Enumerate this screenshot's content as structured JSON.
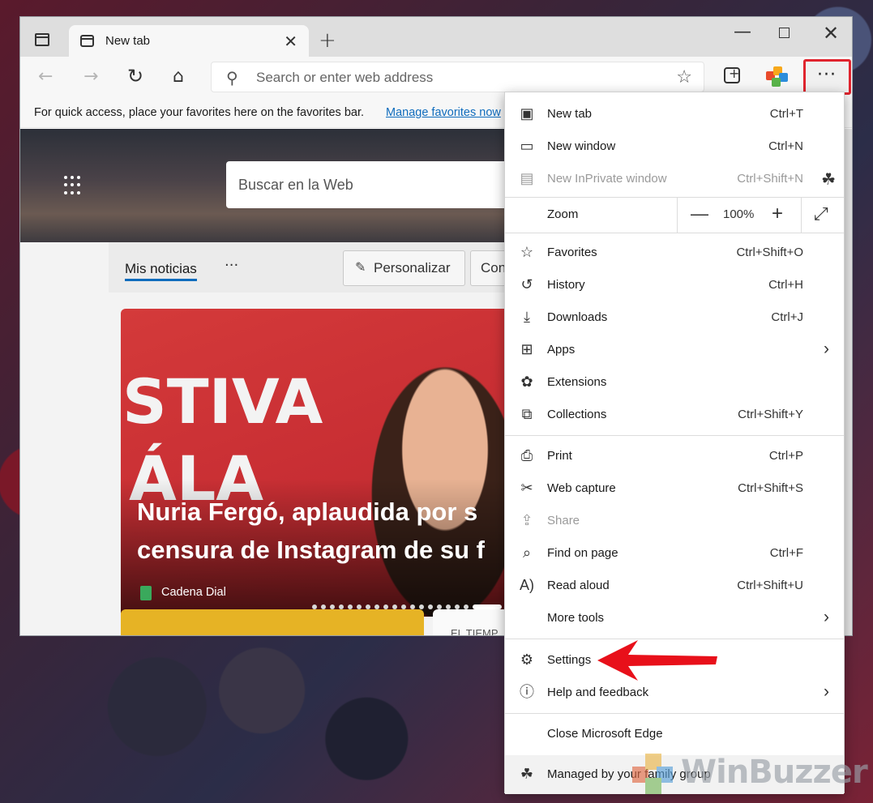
{
  "tab": {
    "title": "New tab"
  },
  "address": {
    "placeholder": "Search or enter web address"
  },
  "favorites_bar": {
    "text": "For quick access, place your favorites here on the favorites bar.",
    "link": "Manage favorites now"
  },
  "page": {
    "web_search_placeholder": "Buscar en la Web",
    "news_tab": "Mis noticias",
    "more": "···",
    "personalize": "Personalizar",
    "second_button": "Con",
    "headline_line1": "Nuria Fergó, aplaudida por s",
    "headline_line2": "censura de Instagram de su f",
    "source": "Cadena Dial",
    "card_big_text_1": "STIVA",
    "card_big_text_2": "ÁLA",
    "weather_label": "EL TIEMP"
  },
  "menu": {
    "items": [
      {
        "label": "New tab",
        "shortcut": "Ctrl+T",
        "icon": "new-tab-icon"
      },
      {
        "label": "New window",
        "shortcut": "Ctrl+N",
        "icon": "new-window-icon"
      },
      {
        "label": "New InPrivate window",
        "shortcut": "Ctrl+Shift+N",
        "icon": "inprivate-icon",
        "disabled": true
      },
      {
        "label": "Favorites",
        "shortcut": "Ctrl+Shift+O",
        "icon": "favorites-icon"
      },
      {
        "label": "History",
        "shortcut": "Ctrl+H",
        "icon": "history-icon"
      },
      {
        "label": "Downloads",
        "shortcut": "Ctrl+J",
        "icon": "downloads-icon"
      },
      {
        "label": "Apps",
        "shortcut": "",
        "icon": "apps-icon"
      },
      {
        "label": "Extensions",
        "shortcut": "",
        "icon": "extensions-icon"
      },
      {
        "label": "Collections",
        "shortcut": "Ctrl+Shift+Y",
        "icon": "collections-icon"
      },
      {
        "label": "Print",
        "shortcut": "Ctrl+P",
        "icon": "print-icon"
      },
      {
        "label": "Web capture",
        "shortcut": "Ctrl+Shift+S",
        "icon": "web-capture-icon"
      },
      {
        "label": "Share",
        "shortcut": "",
        "icon": "share-icon",
        "disabled": true
      },
      {
        "label": "Find on page",
        "shortcut": "Ctrl+F",
        "icon": "find-icon"
      },
      {
        "label": "Read aloud",
        "shortcut": "Ctrl+Shift+U",
        "icon": "read-aloud-icon"
      },
      {
        "label": "More tools",
        "shortcut": "",
        "icon": ""
      },
      {
        "label": "Settings",
        "shortcut": "",
        "icon": "settings-icon"
      },
      {
        "label": "Help and feedback",
        "shortcut": "",
        "icon": "help-icon"
      },
      {
        "label": "Close Microsoft Edge",
        "shortcut": "",
        "icon": ""
      }
    ],
    "zoom": {
      "label": "Zoom",
      "value": "100%",
      "minus": "—",
      "plus": "+"
    },
    "managed": "Managed by your family group"
  },
  "watermark": {
    "text": "WinBuzzer"
  },
  "colors": {
    "accent": "#0f6cbd",
    "highlight": "#e0242e"
  }
}
